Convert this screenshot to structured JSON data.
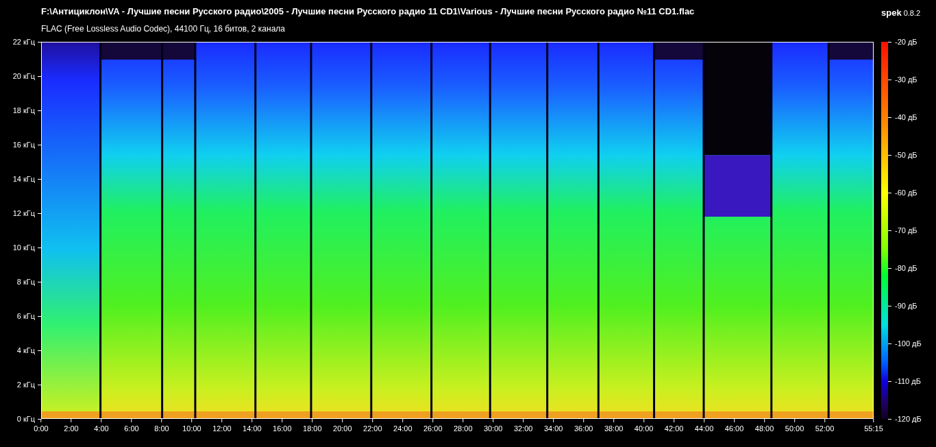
{
  "header": {
    "file_path": "F:\\Антициклон\\VA - Лучшие песни Русского радио\\2005 - Лучшие песни Русского радио 11 CD1\\Various - Лучшие песни Русского радио №11 CD1.flac",
    "stream_info": "FLAC (Free Lossless Audio Codec), 44100 Гц, 16 битов, 2 канала",
    "app_name": "spek",
    "app_version": "0.8.2"
  },
  "spectrogram": {
    "kind": "picture"
  },
  "frequency_axis": [
    "22 кГц",
    "20 кГц",
    "18 кГц",
    "16 кГц",
    "14 кГц",
    "12 кГц",
    "10 кГц",
    "8 кГц",
    "6 кГц",
    "4 кГц",
    "2 кГц",
    "0 кГц"
  ],
  "time_axis": [
    "0:00",
    "2:00",
    "4:00",
    "6:00",
    "8:00",
    "10:00",
    "12:00",
    "14:00",
    "16:00",
    "18:00",
    "20:00",
    "22:00",
    "24:00",
    "26:00",
    "28:00",
    "30:00",
    "32:00",
    "34:00",
    "36:00",
    "38:00",
    "40:00",
    "42:00",
    "44:00",
    "46:00",
    "48:00",
    "50:00",
    "52:00",
    "55:15"
  ],
  "level_scale": [
    "-20 дБ",
    "-30 дБ",
    "-40 дБ",
    "-50 дБ",
    "-60 дБ",
    "-70 дБ",
    "-80 дБ",
    "-90 дБ",
    "-100 дБ",
    "-110 дБ",
    "-120 дБ"
  ]
}
